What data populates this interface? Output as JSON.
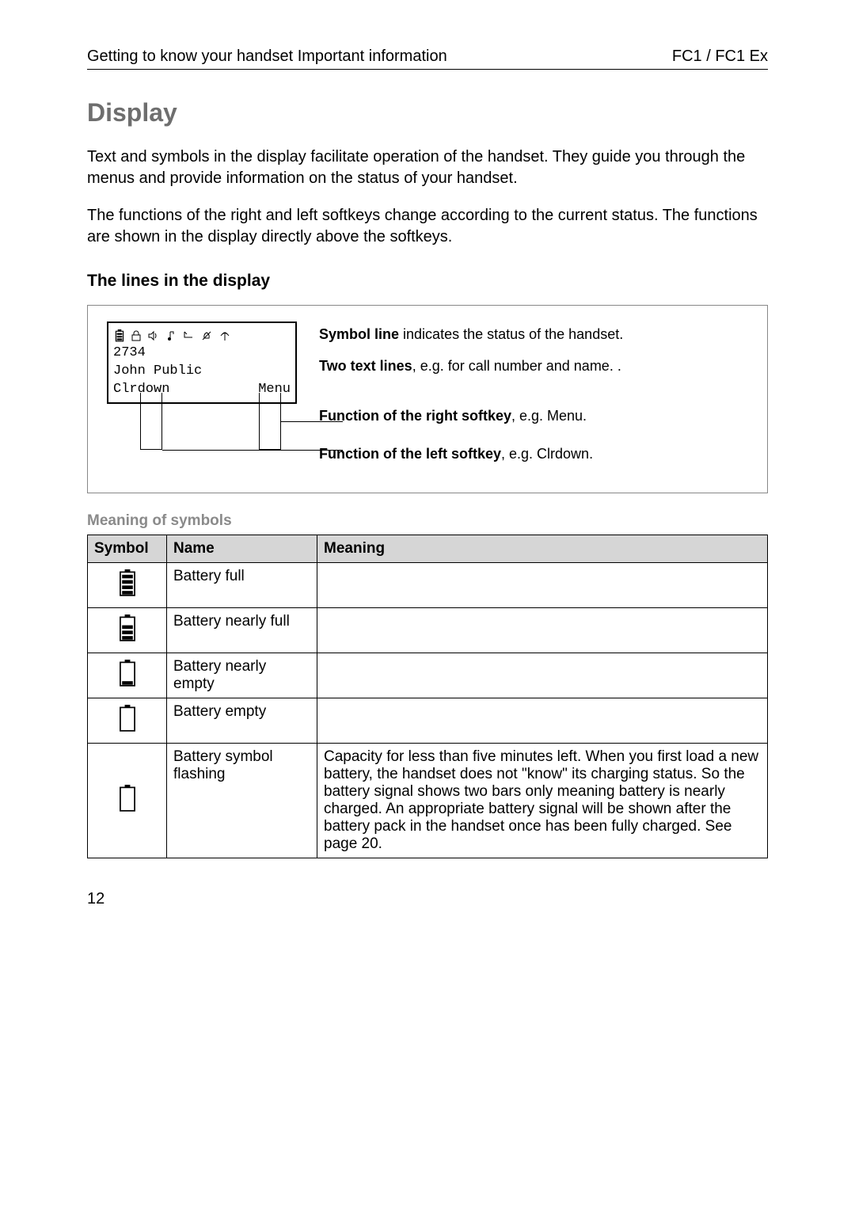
{
  "header": {
    "left": "Getting to know your handset Important information",
    "right": "FC1 / FC1 Ex"
  },
  "title": "Display",
  "para1": "Text and symbols in the display facilitate operation of the handset. They guide you through the menus and provide information on the status of your handset.",
  "para2": "The functions of the right and left softkeys change according to the current status. The functions are shown in the display directly above the softkeys.",
  "lines_heading": "The lines in the display",
  "lcd": {
    "line1": "2734",
    "line2": "John Public",
    "left_softkey": "Clrdown",
    "right_softkey": "Menu"
  },
  "diag": {
    "symbol_line_bold": "Symbol line",
    "symbol_line_rest": " indicates the status of the handset.",
    "two_text_bold": "Two text lines",
    "two_text_rest": ", e.g. for call number and name. .",
    "fn_right_bold": "Function of the right softkey",
    "fn_right_rest": ", e.g. Menu.",
    "fn_left_bold": "Function of the left softkey",
    "fn_left_rest": ", e.g. Clrdown."
  },
  "mos_heading": "Meaning of symbols",
  "table": {
    "col_symbol": "Symbol",
    "col_name": "Name",
    "col_meaning": "Meaning",
    "rows": [
      {
        "name": "Battery full",
        "meaning": ""
      },
      {
        "name": "Battery nearly full",
        "meaning": ""
      },
      {
        "name": "Battery nearly empty",
        "meaning": ""
      },
      {
        "name": "Battery empty",
        "meaning": ""
      },
      {
        "name": "Battery symbol flashing",
        "meaning": "Capacity for less than five minutes left. When you first load a new battery, the handset does not \"know\" its charging status. So the battery signal shows two bars only meaning battery is nearly charged. An appropriate battery signal will be shown after the battery pack in the handset once has been fully charged. See page 20."
      }
    ]
  },
  "page_number": "12"
}
